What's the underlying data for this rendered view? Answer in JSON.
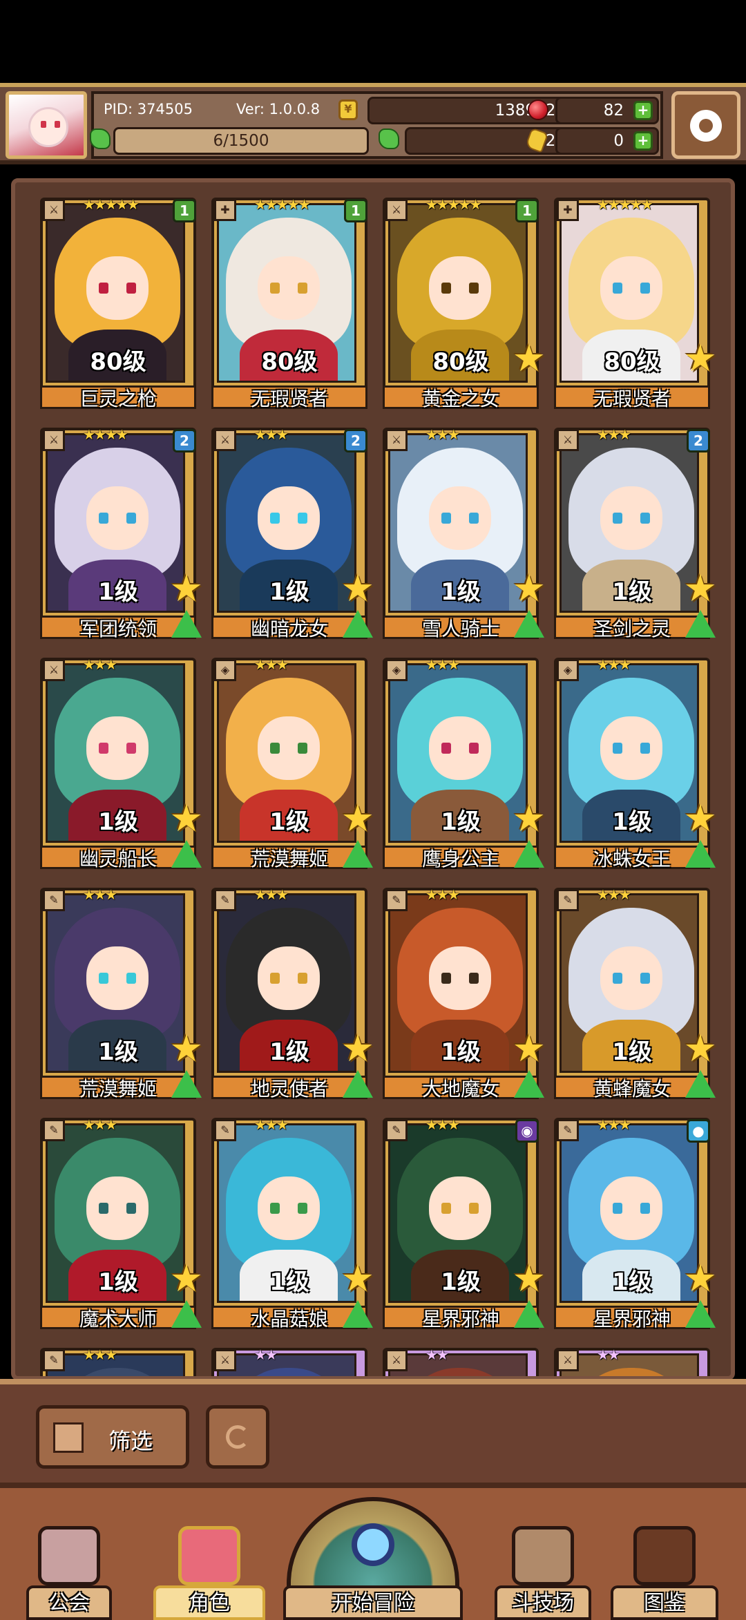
{
  "header": {
    "pid": "PID: 374505",
    "version": "Ver: 1.0.0.8",
    "exp": "6/1500",
    "gold": "1389721",
    "gems": "82",
    "clovers": "27",
    "keys": "0",
    "coin_glyph": "¥"
  },
  "cards": [
    {
      "level": "80级",
      "name": "巨灵之枪",
      "stars": "★★★★★",
      "badge": "1",
      "badge_color": "#4fa23a",
      "hair": "#f2b23a",
      "body": "#2a1e28",
      "eye": "#c02040",
      "bg": "#3a2a2a",
      "star": false,
      "arrow": false,
      "class": "⚔"
    },
    {
      "level": "80级",
      "name": "无瑕贤者",
      "stars": "★★★★★",
      "badge": "1",
      "badge_color": "#4fa23a",
      "hair": "#efe8e0",
      "body": "#c02a3a",
      "eye": "#d8a030",
      "bg": "#6ab8c8",
      "star": false,
      "arrow": false,
      "class": "✚"
    },
    {
      "level": "80级",
      "name": "黄金之女",
      "stars": "★★★★★",
      "badge": "1",
      "badge_color": "#4fa23a",
      "hair": "#d8a82a",
      "body": "#b88a1a",
      "eye": "#5a3a0a",
      "bg": "#6a5020",
      "star": true,
      "arrow": false,
      "class": "⚔"
    },
    {
      "level": "80级",
      "name": "无瑕贤者",
      "stars": "★★★★★",
      "badge": "",
      "badge_color": "",
      "hair": "#f6d68a",
      "body": "#f0f0f0",
      "eye": "#38a8d8",
      "bg": "#e8d8d8",
      "star": true,
      "arrow": false,
      "class": "✚"
    },
    {
      "level": "1级",
      "name": "军团统领",
      "stars": "★★★★",
      "badge": "2",
      "badge_color": "#3a8ad0",
      "hair": "#d8d0e8",
      "body": "#5a3a7a",
      "eye": "#38a8d8",
      "bg": "#3a3050",
      "star": true,
      "arrow": true,
      "class": "⚔"
    },
    {
      "level": "1级",
      "name": "幽暗龙女",
      "stars": "★★★",
      "badge": "2",
      "badge_color": "#3a8ad0",
      "hair": "#2a5a9a",
      "body": "#1a3a5a",
      "eye": "#38c8e8",
      "bg": "#2a4050",
      "star": true,
      "arrow": true,
      "class": "⚔"
    },
    {
      "level": "1级",
      "name": "雪人骑士",
      "stars": "★★★",
      "badge": "",
      "badge_color": "",
      "hair": "#e8f0f8",
      "body": "#4a6a9a",
      "eye": "#38a8d8",
      "bg": "#6a8aa8",
      "star": true,
      "arrow": true,
      "class": "⚔"
    },
    {
      "level": "1级",
      "name": "圣剑之灵",
      "stars": "★★★",
      "badge": "2",
      "badge_color": "#3a8ad0",
      "hair": "#d8dce8",
      "body": "#c8b08a",
      "eye": "#38a8d8",
      "bg": "#4a4a4a",
      "star": true,
      "arrow": true,
      "class": "⚔"
    },
    {
      "level": "1级",
      "name": "幽灵船长",
      "stars": "★★★",
      "badge": "",
      "badge_color": "",
      "hair": "#4aa890",
      "body": "#8a1a2a",
      "eye": "#d03a6a",
      "bg": "#2a4a4a",
      "star": true,
      "arrow": true,
      "class": "⚔"
    },
    {
      "level": "1级",
      "name": "荒漠舞姬",
      "stars": "★★★",
      "badge": "",
      "badge_color": "",
      "hair": "#f2b04a",
      "body": "#c8342a",
      "eye": "#3a8a3a",
      "bg": "#7a4a2a",
      "star": true,
      "arrow": true,
      "class": "◈"
    },
    {
      "level": "1级",
      "name": "鹰身公主",
      "stars": "★★★",
      "badge": "",
      "badge_color": "",
      "hair": "#5ad0d8",
      "body": "#8a5a3a",
      "eye": "#c02a5a",
      "bg": "#3a6a8a",
      "star": true,
      "arrow": true,
      "class": "◈"
    },
    {
      "level": "1级",
      "name": "冰蛛女王",
      "stars": "★★★",
      "badge": "",
      "badge_color": "",
      "hair": "#6ad0e8",
      "body": "#2a4a6a",
      "eye": "#38a8d8",
      "bg": "#3a6a8a",
      "star": true,
      "arrow": true,
      "class": "◈"
    },
    {
      "level": "1级",
      "name": "荒漠舞姬",
      "stars": "★★★",
      "badge": "",
      "badge_color": "",
      "hair": "#4a3a6a",
      "body": "#2a3a4a",
      "eye": "#38c8d8",
      "bg": "#3a3a5a",
      "star": true,
      "arrow": true,
      "class": "✎"
    },
    {
      "level": "1级",
      "name": "地灵使者",
      "stars": "★★★",
      "badge": "",
      "badge_color": "",
      "hair": "#2a2a2a",
      "body": "#a01a1a",
      "eye": "#d8a030",
      "bg": "#2a2a3a",
      "star": true,
      "arrow": true,
      "class": "✎"
    },
    {
      "level": "1级",
      "name": "大地魔女",
      "stars": "★★★",
      "badge": "",
      "badge_color": "",
      "hair": "#c85a2a",
      "body": "#8a3a1a",
      "eye": "#3a2a1a",
      "bg": "#7a3a1a",
      "star": true,
      "arrow": true,
      "class": "✎"
    },
    {
      "level": "1级",
      "name": "黄蜂魔女",
      "stars": "★★★",
      "badge": "",
      "badge_color": "",
      "hair": "#d8dce8",
      "body": "#d89a2a",
      "eye": "#38a8d8",
      "bg": "#6a4a2a",
      "star": true,
      "arrow": true,
      "class": "✎"
    },
    {
      "level": "1级",
      "name": "魔术大师",
      "stars": "★★★",
      "badge": "",
      "badge_color": "",
      "hair": "#3a8a6a",
      "body": "#b01a2a",
      "eye": "#2a6a6a",
      "bg": "#2a4a3a",
      "star": true,
      "arrow": true,
      "class": "✎"
    },
    {
      "level": "1级",
      "name": "水晶菇娘",
      "stars": "★★★",
      "badge": "",
      "badge_color": "",
      "hair": "#3ab8d8",
      "body": "#f0f0f0",
      "eye": "#3a9a4a",
      "bg": "#4a8aaa",
      "star": true,
      "arrow": true,
      "class": "✎"
    },
    {
      "level": "1级",
      "name": "星界邪神",
      "stars": "★★★",
      "badge": "◉",
      "badge_color": "#6a3aa0",
      "hair": "#2a5a3a",
      "body": "#4a2a1a",
      "eye": "#d8a030",
      "bg": "#1a3a2a",
      "star": true,
      "arrow": true,
      "class": "✎"
    },
    {
      "level": "1级",
      "name": "星界邪神",
      "stars": "★★★",
      "badge": "●",
      "badge_color": "#3aa8d8",
      "hair": "#5ab8e8",
      "body": "#d8e8f0",
      "eye": "#38a8d8",
      "bg": "#3a6a9a",
      "star": true,
      "arrow": true,
      "class": "✎"
    },
    {
      "level": "",
      "name": "",
      "stars": "★★★",
      "badge": "",
      "badge_color": "",
      "hair": "#3a4a6a",
      "body": "#2a2a3a",
      "eye": "#38a8d8",
      "bg": "#2a3a5a",
      "star": false,
      "arrow": false,
      "class": "✎",
      "partial": true
    },
    {
      "level": "",
      "name": "",
      "stars": "★★",
      "badge": "",
      "badge_color": "",
      "hair": "#3a4a8a",
      "body": "#2a2a3a",
      "eye": "#38a8d8",
      "bg": "#3a3a5a",
      "star": false,
      "arrow": false,
      "class": "⚔",
      "partial": true,
      "purple": true
    },
    {
      "level": "",
      "name": "",
      "stars": "★★",
      "badge": "",
      "badge_color": "",
      "hair": "#8a3a2a",
      "body": "#2a2a3a",
      "eye": "#38a8d8",
      "bg": "#5a3a3a",
      "star": false,
      "arrow": false,
      "class": "⚔",
      "partial": true,
      "purple": true
    },
    {
      "level": "",
      "name": "",
      "stars": "★★",
      "badge": "",
      "badge_color": "",
      "hair": "#c87a2a",
      "body": "#2a2a3a",
      "eye": "#38a8d8",
      "bg": "#7a5a3a",
      "star": false,
      "arrow": false,
      "class": "⚔",
      "partial": true,
      "purple": true
    }
  ],
  "filter": {
    "label": "筛选"
  },
  "nav": {
    "guild": "公会",
    "character": "角色",
    "adventure": "开始冒险",
    "arena": "斗技场",
    "codex": "图鉴"
  }
}
